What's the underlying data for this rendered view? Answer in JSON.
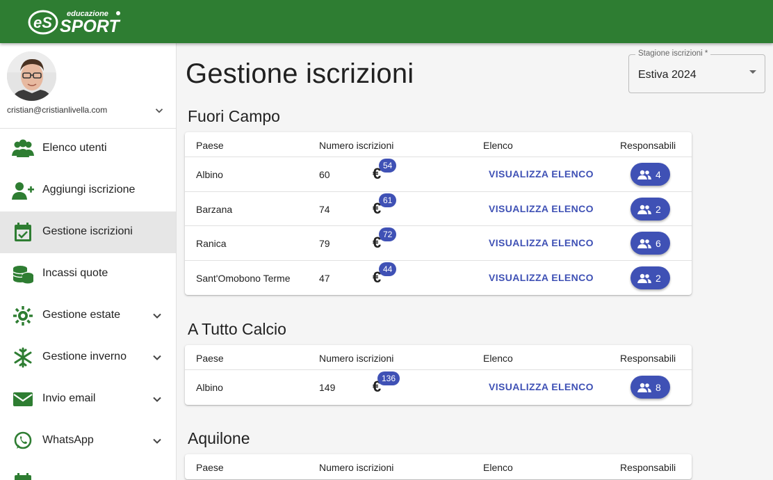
{
  "brand": {
    "name_top": "educazione",
    "name_bottom": "SPORT",
    "mark": "eS",
    "color": "#2e7d32"
  },
  "user": {
    "email": "cristian@cristianlivella.com"
  },
  "nav": [
    {
      "label": "Elenco utenti",
      "icon": "users-icon",
      "expandable": false,
      "active": false
    },
    {
      "label": "Aggiungi iscrizione",
      "icon": "person-add-icon",
      "expandable": false,
      "active": false
    },
    {
      "label": "Gestione iscrizioni",
      "icon": "calendar-check-icon",
      "expandable": false,
      "active": true
    },
    {
      "label": "Incassi quote",
      "icon": "coins-icon",
      "expandable": false,
      "active": false
    },
    {
      "label": "Gestione estate",
      "icon": "sun-icon",
      "expandable": true,
      "active": false
    },
    {
      "label": "Gestione inverno",
      "icon": "snowflake-icon",
      "expandable": true,
      "active": false
    },
    {
      "label": "Invio email",
      "icon": "mail-icon",
      "expandable": true,
      "active": false
    },
    {
      "label": "WhatsApp",
      "icon": "whatsapp-icon",
      "expandable": true,
      "active": false
    }
  ],
  "page": {
    "title": "Gestione iscrizioni"
  },
  "season_select": {
    "label": "Stagione iscrizioni *",
    "value": "Estiva 2024"
  },
  "table_headers": {
    "paese": "Paese",
    "numero": "Numero iscrizioni",
    "elenco": "Elenco",
    "responsabili": "Responsabili"
  },
  "link_label": "VISUALIZZA ELENCO",
  "currency_symbol": "€",
  "accent_color": "#3f51b5",
  "sections": [
    {
      "title": "Fuori Campo",
      "rows": [
        {
          "paese": "Albino",
          "numero": "60",
          "pagati": "54",
          "responsabili": "4"
        },
        {
          "paese": "Barzana",
          "numero": "74",
          "pagati": "61",
          "responsabili": "2"
        },
        {
          "paese": "Ranica",
          "numero": "79",
          "pagati": "72",
          "responsabili": "6"
        },
        {
          "paese": "Sant'Omobono Terme",
          "numero": "47",
          "pagati": "44",
          "responsabili": "2"
        }
      ]
    },
    {
      "title": "A Tutto Calcio",
      "rows": [
        {
          "paese": "Albino",
          "numero": "149",
          "pagati": "136",
          "responsabili": "8"
        }
      ]
    },
    {
      "title": "Aquilone",
      "rows": []
    }
  ]
}
